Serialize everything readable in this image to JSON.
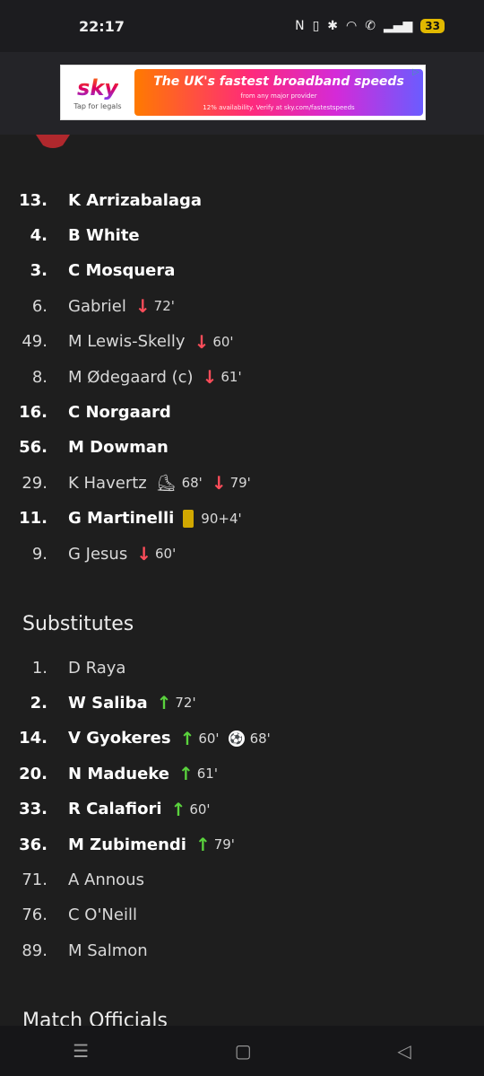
{
  "status": {
    "time": "22:17",
    "battery": "33"
  },
  "ad": {
    "brand": "sky",
    "legal": "Tap for legals",
    "headline": "The UK's fastest broadband speeds",
    "sub1": "from any major provider",
    "sub2": "12% availability. Verify at sky.com/fastestspeeds"
  },
  "lineup": [
    {
      "num": "13.",
      "name": "K  Arrizabalaga",
      "bold": true,
      "events": []
    },
    {
      "num": "4.",
      "name": "B  White",
      "bold": true,
      "events": []
    },
    {
      "num": "3.",
      "name": "C  Mosquera",
      "bold": true,
      "events": []
    },
    {
      "num": "6.",
      "name": "Gabriel",
      "bold": false,
      "events": [
        {
          "type": "sub-off",
          "text": "72'"
        }
      ]
    },
    {
      "num": "49.",
      "name": "M  Lewis-Skelly",
      "bold": false,
      "events": [
        {
          "type": "sub-off",
          "text": "60'"
        }
      ]
    },
    {
      "num": "8.",
      "name": "M  Ødegaard (c)",
      "bold": false,
      "events": [
        {
          "type": "sub-off",
          "text": "61'"
        }
      ]
    },
    {
      "num": "16.",
      "name": "C  Norgaard",
      "bold": true,
      "events": []
    },
    {
      "num": "56.",
      "name": "M  Dowman",
      "bold": true,
      "events": []
    },
    {
      "num": "29.",
      "name": "K  Havertz",
      "bold": false,
      "events": [
        {
          "type": "assist",
          "text": "68'"
        },
        {
          "type": "sub-off",
          "text": "79'"
        }
      ]
    },
    {
      "num": "11.",
      "name": "G  Martinelli",
      "bold": true,
      "events": [
        {
          "type": "yellow-card",
          "text": "90+4'"
        }
      ]
    },
    {
      "num": "9.",
      "name": "G  Jesus",
      "bold": false,
      "events": [
        {
          "type": "sub-off",
          "text": "60'"
        }
      ]
    }
  ],
  "substitutes_title": "Substitutes",
  "substitutes": [
    {
      "num": "1.",
      "name": "D  Raya",
      "bold": false,
      "events": []
    },
    {
      "num": "2.",
      "name": "W  Saliba",
      "bold": true,
      "events": [
        {
          "type": "sub-on",
          "text": "72'"
        }
      ]
    },
    {
      "num": "14.",
      "name": "V  Gyokeres",
      "bold": true,
      "events": [
        {
          "type": "sub-on",
          "text": "60'"
        },
        {
          "type": "goal",
          "text": "68'"
        }
      ]
    },
    {
      "num": "20.",
      "name": "N  Madueke",
      "bold": true,
      "events": [
        {
          "type": "sub-on",
          "text": "61'"
        }
      ]
    },
    {
      "num": "33.",
      "name": "R  Calafiori",
      "bold": true,
      "events": [
        {
          "type": "sub-on",
          "text": "60'"
        }
      ]
    },
    {
      "num": "36.",
      "name": "M  Zubimendi",
      "bold": true,
      "events": [
        {
          "type": "sub-on",
          "text": "79'"
        }
      ]
    },
    {
      "num": "71.",
      "name": "A  Annous",
      "bold": false,
      "events": []
    },
    {
      "num": "76.",
      "name": "C  O'Neill",
      "bold": false,
      "events": []
    },
    {
      "num": "89.",
      "name": "M  Salmon",
      "bold": false,
      "events": []
    }
  ],
  "officials_title": "Match Officials",
  "colors": {
    "sub_off": "#ff4d5a",
    "sub_on": "#5ad33d",
    "yellow_card": "#d1a800"
  }
}
